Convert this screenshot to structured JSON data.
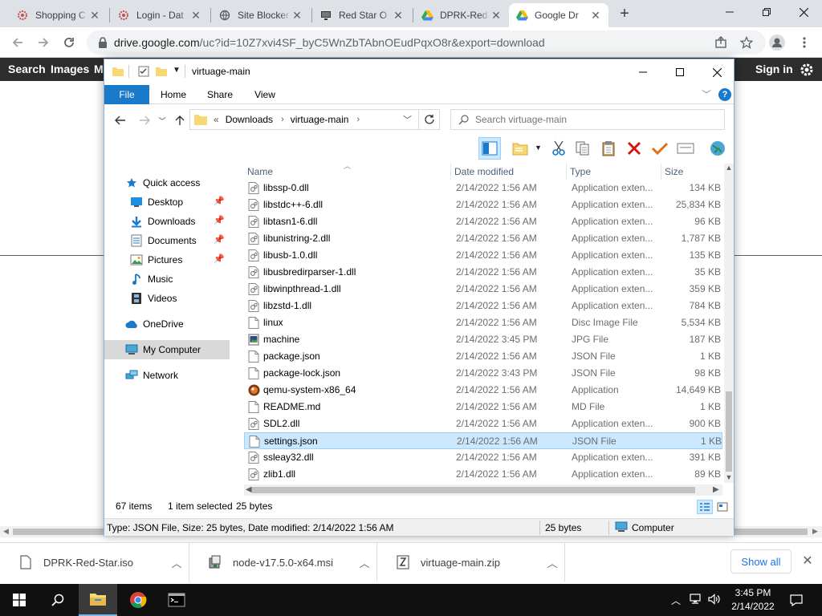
{
  "browser": {
    "tabs": [
      {
        "title": "Shopping C",
        "icon": "gear-icon"
      },
      {
        "title": "Login - Dat",
        "icon": "gear-icon"
      },
      {
        "title": "Site Blocker",
        "icon": "globe-icon"
      },
      {
        "title": "Red Star O",
        "icon": "monitor-icon"
      },
      {
        "title": "DPRK-Red-",
        "icon": "google-drive-icon"
      },
      {
        "title": "Google Dr",
        "icon": "google-drive-icon",
        "active": true
      }
    ],
    "url_host": "drive.google.com",
    "url_path": "/uc?id=10Z7xvi4SF_byC5WnZbTAbnOEudPqxO8r&export=download"
  },
  "page": {
    "nav_items": [
      "Search",
      "Images",
      "M"
    ],
    "sign_in": "Sign in"
  },
  "explorer": {
    "title": "virtuage-main",
    "ribbon_tabs": [
      "File",
      "Home",
      "Share",
      "View"
    ],
    "breadcrumb": [
      "Downloads",
      "virtuage-main"
    ],
    "breadcrumb_prefix": "«",
    "search_placeholder": "Search virtuage-main",
    "nav": {
      "quick_access": "Quick access",
      "quick_items": [
        {
          "label": "Desktop",
          "pinned": true
        },
        {
          "label": "Downloads",
          "pinned": true
        },
        {
          "label": "Documents",
          "pinned": true
        },
        {
          "label": "Pictures",
          "pinned": true
        },
        {
          "label": "Music",
          "pinned": false
        },
        {
          "label": "Videos",
          "pinned": false
        }
      ],
      "onedrive": "OneDrive",
      "my_computer": "My Computer",
      "network": "Network"
    },
    "columns": {
      "name": "Name",
      "date": "Date modified",
      "type": "Type",
      "size": "Size"
    },
    "files": [
      {
        "name": "libssp-0.dll",
        "date": "2/14/2022 1:56 AM",
        "type": "Application exten...",
        "size": "134 KB",
        "icon": "dll"
      },
      {
        "name": "libstdc++-6.dll",
        "date": "2/14/2022 1:56 AM",
        "type": "Application exten...",
        "size": "25,834 KB",
        "icon": "dll"
      },
      {
        "name": "libtasn1-6.dll",
        "date": "2/14/2022 1:56 AM",
        "type": "Application exten...",
        "size": "96 KB",
        "icon": "dll"
      },
      {
        "name": "libunistring-2.dll",
        "date": "2/14/2022 1:56 AM",
        "type": "Application exten...",
        "size": "1,787 KB",
        "icon": "dll"
      },
      {
        "name": "libusb-1.0.dll",
        "date": "2/14/2022 1:56 AM",
        "type": "Application exten...",
        "size": "135 KB",
        "icon": "dll"
      },
      {
        "name": "libusbredirparser-1.dll",
        "date": "2/14/2022 1:56 AM",
        "type": "Application exten...",
        "size": "35 KB",
        "icon": "dll"
      },
      {
        "name": "libwinpthread-1.dll",
        "date": "2/14/2022 1:56 AM",
        "type": "Application exten...",
        "size": "359 KB",
        "icon": "dll"
      },
      {
        "name": "libzstd-1.dll",
        "date": "2/14/2022 1:56 AM",
        "type": "Application exten...",
        "size": "784 KB",
        "icon": "dll"
      },
      {
        "name": "linux",
        "date": "2/14/2022 1:56 AM",
        "type": "Disc Image File",
        "size": "5,534 KB",
        "icon": "file"
      },
      {
        "name": "machine",
        "date": "2/14/2022 3:45 PM",
        "type": "JPG File",
        "size": "187 KB",
        "icon": "image"
      },
      {
        "name": "package.json",
        "date": "2/14/2022 1:56 AM",
        "type": "JSON File",
        "size": "1 KB",
        "icon": "file"
      },
      {
        "name": "package-lock.json",
        "date": "2/14/2022 3:43 PM",
        "type": "JSON File",
        "size": "98 KB",
        "icon": "file"
      },
      {
        "name": "qemu-system-x86_64",
        "date": "2/14/2022 1:56 AM",
        "type": "Application",
        "size": "14,649 KB",
        "icon": "qemu"
      },
      {
        "name": "README.md",
        "date": "2/14/2022 1:56 AM",
        "type": "MD File",
        "size": "1 KB",
        "icon": "file"
      },
      {
        "name": "SDL2.dll",
        "date": "2/14/2022 1:56 AM",
        "type": "Application exten...",
        "size": "900 KB",
        "icon": "dll"
      },
      {
        "name": "settings.json",
        "date": "2/14/2022 1:56 AM",
        "type": "JSON File",
        "size": "1 KB",
        "icon": "file",
        "selected": true
      },
      {
        "name": "ssleay32.dll",
        "date": "2/14/2022 1:56 AM",
        "type": "Application exten...",
        "size": "391 KB",
        "icon": "dll"
      },
      {
        "name": "zlib1.dll",
        "date": "2/14/2022 1:56 AM",
        "type": "Application exten...",
        "size": "89 KB",
        "icon": "dll"
      }
    ],
    "status": {
      "items": "67 items",
      "selected": "1 item selected",
      "bytes": "25 bytes"
    },
    "details": {
      "info": "Type: JSON File, Size: 25 bytes, Date modified: 2/14/2022 1:56 AM",
      "size": "25 bytes",
      "location": "Computer"
    }
  },
  "downloads": {
    "items": [
      "DPRK-Red-Star.iso",
      "node-v17.5.0-x64.msi",
      "virtuage-main.zip"
    ],
    "show_all": "Show all"
  },
  "taskbar": {
    "time": "3:45 PM",
    "date": "2/14/2022"
  }
}
